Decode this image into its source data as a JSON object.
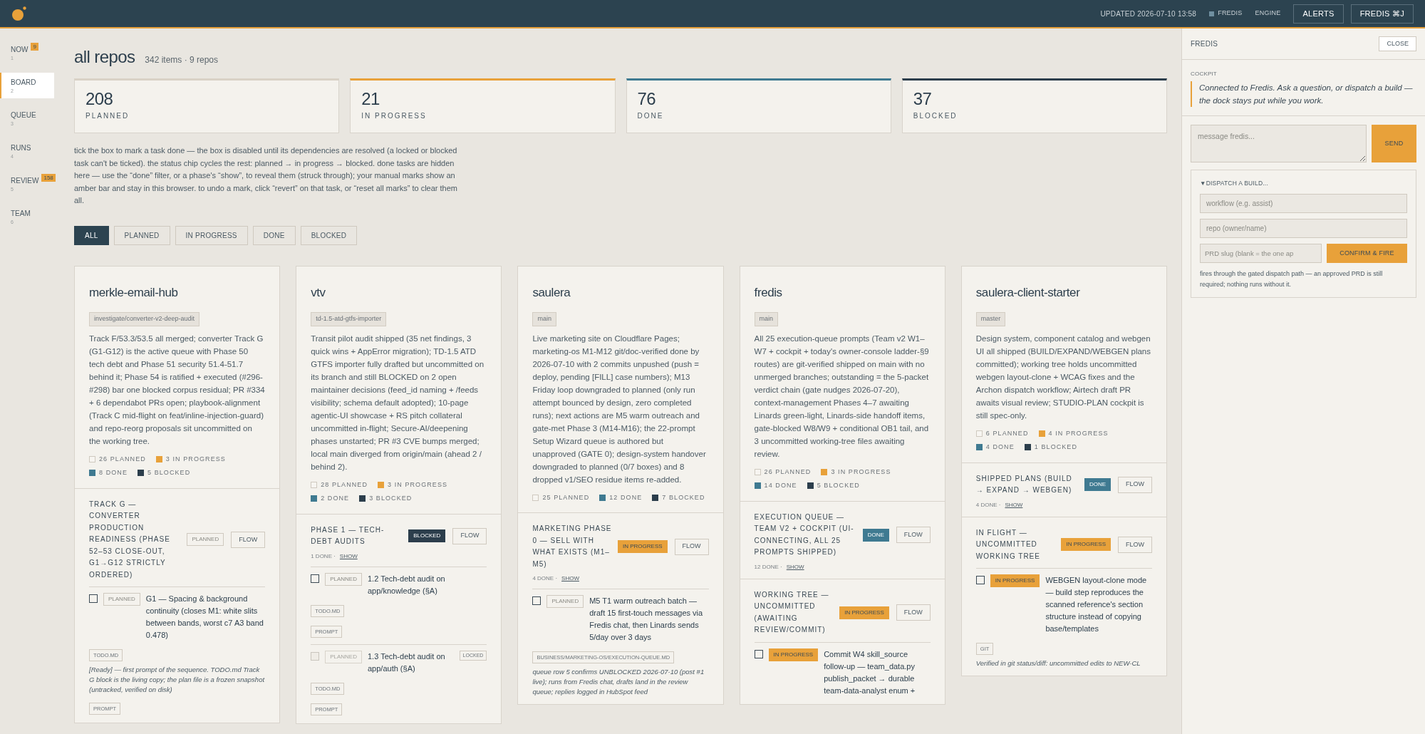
{
  "topbar": {
    "updated": "UPDATED 2026-07-10 13:58",
    "links": [
      {
        "label": "FREDIS",
        "indicator": true
      },
      {
        "label": "ENGINE",
        "indicator": false
      }
    ],
    "buttons": [
      "ALERTS",
      "FREDIS ⌘J"
    ]
  },
  "sidebar": {
    "items": [
      {
        "label": "NOW",
        "key": "1",
        "badge": "9",
        "selected": false
      },
      {
        "label": "BOARD",
        "key": "2",
        "selected": true
      },
      {
        "label": "QUEUE",
        "key": "3",
        "selected": false
      },
      {
        "label": "RUNS",
        "key": "4",
        "selected": false
      },
      {
        "label": "REVIEW",
        "key": "5",
        "badge": "158",
        "selected": false
      },
      {
        "label": "TEAM",
        "key": "6",
        "selected": false
      }
    ]
  },
  "header": {
    "title": "all repos",
    "subtitle": "342 items · 9 repos"
  },
  "stats": [
    {
      "value": "208",
      "label": "PLANNED",
      "color": "#d9d2c6"
    },
    {
      "value": "21",
      "label": "IN PROGRESS",
      "color": "#e8a13a"
    },
    {
      "value": "76",
      "label": "DONE",
      "color": "#3f7a91"
    },
    {
      "value": "37",
      "label": "BLOCKED",
      "color": "#2c3e4c"
    }
  ],
  "help": "tick the box to mark a task done — the box is disabled until its dependencies are resolved (a locked or blocked task can't be ticked). the status chip cycles the rest: planned → in progress → blocked. done tasks are hidden here — use the “done” filter, or a phase's “show”, to reveal them (struck through); your manual marks show an amber bar and stay in this browser. to undo a mark, click “revert” on that task, or “reset all marks” to clear them all.",
  "filters": [
    {
      "label": "ALL",
      "selected": true
    },
    {
      "label": "PLANNED",
      "selected": false
    },
    {
      "label": "IN PROGRESS",
      "selected": false
    },
    {
      "label": "DONE",
      "selected": false
    },
    {
      "label": "BLOCKED",
      "selected": false
    }
  ],
  "repos": [
    {
      "name": "merkle-email-hub",
      "branch": "investigate/converter-v2-deep-audit",
      "summary": "Track F/53.3/53.5 all merged; converter Track G (G1-G12) is the active queue with Phase 50 tech debt and Phase 51 security 51.4-51.7 behind it; Phase 54 is ratified + executed (#296-#298) bar one blocked corpus residual; PR #334 + 6 dependabot PRs open; playbook-alignment (Track C mid-flight on feat/inline-injection-guard) and repo-reorg proposals sit uncommitted on the working tree.",
      "counts": [
        {
          "label": "26 PLANNED",
          "kind": "planned"
        },
        {
          "label": "3 IN PROGRESS",
          "kind": "in_progress"
        },
        {
          "label": "8 DONE",
          "kind": "done"
        },
        {
          "label": "5 BLOCKED",
          "kind": "blocked"
        }
      ],
      "sections": [
        {
          "title": "TRACK G — CONVERTER PRODUCTION READINESS (PHASE 52–53 CLOSE-OUT, G1→G12 STRICTLY ORDERED)",
          "kind": "planned",
          "chip": "PLANNED",
          "flow": "FLOW",
          "tasks": [
            {
              "checked": false,
              "disabled": false,
              "kind": "planned",
              "chip": "PLANNED",
              "title": "G1 — Spacing & background continuity (closes M1: white slits between bands, worst c7 A3 band 0.478)",
              "items": [
                {
                  "kind": "tag",
                  "text": "TODO.MD"
                },
                {
                  "kind": "note",
                  "text": "[Ready] — first prompt of the sequence. TODO.md Track G block is the living copy; the plan file is a frozen snapshot (untracked, verified on disk)"
                },
                {
                  "kind": "tag",
                  "text": "PROMPT"
                }
              ]
            }
          ]
        }
      ]
    },
    {
      "name": "vtv",
      "branch": "td-1.5-atd-gtfs-importer",
      "summary": "Transit pilot audit shipped (35 net findings, 3 quick wins + AppError migration); TD-1.5 ATD GTFS importer fully drafted but uncommitted on its branch and still BLOCKED on 2 open maintainer decisions (feed_id naming + /feeds visibility; schema default adopted); 10-page agentic-UI showcase + RS pitch collateral uncommitted in-flight; Secure-AI/deepening phases unstarted; PR #3 CVE bumps merged; local main diverged from origin/main (ahead 2 / behind 2).",
      "counts": [
        {
          "label": "28 PLANNED",
          "kind": "planned"
        },
        {
          "label": "3 IN PROGRESS",
          "kind": "in_progress"
        },
        {
          "label": "2 DONE",
          "kind": "done"
        },
        {
          "label": "3 BLOCKED",
          "kind": "blocked"
        }
      ],
      "sections": [
        {
          "title": "PHASE 1 — TECH-DEBT AUDITS",
          "kind": "blocked",
          "chip": "BLOCKED",
          "flow": "FLOW",
          "meta": "1 DONE ·",
          "show": "SHOW",
          "tasks": [
            {
              "checked": false,
              "disabled": false,
              "kind": "planned",
              "chip": "PLANNED",
              "title": "1.2 Tech-debt audit on app/knowledge (§A)",
              "items": [
                {
                  "kind": "tag",
                  "text": "TODO.MD"
                },
                {
                  "kind": "tag",
                  "text": "PROMPT"
                }
              ]
            },
            {
              "checked": false,
              "disabled": true,
              "kind": "planned",
              "chip": "PLANNED",
              "title": "1.3 Tech-debt audit on app/auth (§A)",
              "lock": "LOCKED",
              "items": [
                {
                  "kind": "tag",
                  "text": "TODO.MD"
                },
                {
                  "kind": "tag",
                  "text": "PROMPT"
                }
              ]
            }
          ]
        }
      ]
    },
    {
      "name": "saulera",
      "branch": "main",
      "summary": "Live marketing site on Cloudflare Pages; marketing-os M1-M12 git/doc-verified done by 2026-07-10 with 2 commits unpushed (push = deploy, pending [FILL] case numbers); M13 Friday loop downgraded to planned (only run attempt bounced by design, zero completed runs); next actions are M5 warm outreach and gate-met Phase 3 (M14-M16); the 22-prompt Setup Wizard queue is authored but unapproved (GATE 0); design-system handover downgraded to planned (0/7 boxes) and 8 dropped v1/SEO residue items re-added.",
      "counts": [
        {
          "label": "25 PLANNED",
          "kind": "planned"
        },
        {
          "label": "12 DONE",
          "kind": "done"
        },
        {
          "label": "7 BLOCKED",
          "kind": "blocked"
        }
      ],
      "sections": [
        {
          "title": "MARKETING PHASE 0 — SELL WITH WHAT EXISTS (M1–M5)",
          "kind": "in_progress",
          "chip": "IN PROGRESS",
          "flow": "FLOW",
          "meta": "4 DONE ·",
          "show": "SHOW",
          "tasks": [
            {
              "checked": false,
              "disabled": false,
              "kind": "planned",
              "chip": "PLANNED",
              "title": "M5 T1 warm outreach batch — draft 15 first-touch messages via Fredis chat, then Linards sends 5/day over 3 days",
              "items": [
                {
                  "kind": "tag",
                  "text": "BUSINESS/MARKETING-OS/EXECUTION-QUEUE.MD"
                },
                {
                  "kind": "note",
                  "text": "queue row 5 confirms UNBLOCKED 2026-07-10 (post #1 live); runs from Fredis chat, drafts land in the review queue; replies logged in HubSpot feed"
                }
              ]
            }
          ]
        }
      ]
    },
    {
      "name": "fredis",
      "branch": "main",
      "summary": "All 25 execution-queue prompts (Team v2 W1–W7 + cockpit + today's owner-console ladder-§9 routes) are git-verified shipped on main with no unmerged branches; outstanding = the 5-packet verdict chain (gate nudges 2026-07-20), context-management Phases 4–7 awaiting Linards green-light, Linards-side handoff items, gate-blocked W8/W9 + conditional OB1 tail, and 3 uncommitted working-tree files awaiting review.",
      "counts": [
        {
          "label": "26 PLANNED",
          "kind": "planned"
        },
        {
          "label": "3 IN PROGRESS",
          "kind": "in_progress"
        },
        {
          "label": "14 DONE",
          "kind": "done"
        },
        {
          "label": "5 BLOCKED",
          "kind": "blocked"
        }
      ],
      "sections": [
        {
          "title": "EXECUTION QUEUE — TEAM V2 + COCKPIT (UI-CONNECTING, ALL 25 PROMPTS SHIPPED)",
          "kind": "done",
          "chip": "DONE",
          "flow": "FLOW",
          "meta": "12 DONE ·",
          "show": "SHOW"
        },
        {
          "title": "WORKING TREE — UNCOMMITTED (AWAITING REVIEW/COMMIT)",
          "kind": "in_progress",
          "chip": "IN PROGRESS",
          "flow": "FLOW",
          "tasks": [
            {
              "checked": false,
              "disabled": false,
              "kind": "in_progress",
              "chip": "IN PROGRESS",
              "title": "Commit W4 skill_source follow-up — team_data.py publish_packet → durable team-data-analyst enum +"
            }
          ]
        }
      ]
    },
    {
      "name": "saulera-client-starter",
      "branch": "master",
      "summary": "Design system, component catalog and webgen UI all shipped (BUILD/EXPAND/WEBGEN plans committed); working tree holds uncommitted webgen layout-clone + WCAG fixes and the Archon dispatch workflow; Airtech draft PR awaits visual review; STUDIO-PLAN cockpit is still spec-only.",
      "counts": [
        {
          "label": "6 PLANNED",
          "kind": "planned"
        },
        {
          "label": "4 IN PROGRESS",
          "kind": "in_progress"
        },
        {
          "label": "4 DONE",
          "kind": "done"
        },
        {
          "label": "1 BLOCKED",
          "kind": "blocked"
        }
      ],
      "sections": [
        {
          "title": "SHIPPED PLANS (BUILD → EXPAND → WEBGEN)",
          "kind": "done",
          "chip": "DONE",
          "flow": "FLOW",
          "meta": "4 DONE ·",
          "show": "SHOW"
        },
        {
          "title": "IN FLIGHT — UNCOMMITTED WORKING TREE",
          "kind": "in_progress",
          "chip": "IN PROGRESS",
          "flow": "FLOW",
          "tasks": [
            {
              "checked": false,
              "disabled": false,
              "kind": "in_progress",
              "chip": "IN PROGRESS",
              "title": "WEBGEN layout-clone mode — build step reproduces the scanned reference's section structure instead of copying base/templates",
              "items": [
                {
                  "kind": "tag",
                  "text": "GIT"
                },
                {
                  "kind": "note",
                  "text": "Verified in git status/diff: uncommitted edits to NEW-CL"
                }
              ]
            }
          ]
        }
      ]
    }
  ],
  "dock": {
    "title": "FREDIS",
    "close": "CLOSE",
    "cockpit_label": "COCKPIT",
    "message": "Connected to Fredis. Ask a question, or dispatch a build — the dock stays put while you work.",
    "input": {
      "placeholder": "message fredis..."
    },
    "send": "SEND",
    "dispatch": {
      "summary": "▼DISPATCH A BUILD...",
      "fields": [
        {
          "placeholder": "workflow (e.g. assist)"
        },
        {
          "placeholder": "repo (owner/name)"
        },
        {
          "placeholder": "PRD slug (blank = the one ap"
        }
      ],
      "button": "CONFIRM & FIRE",
      "note": "fires through the gated dispatch path — an approved PRD is still required; nothing runs without it."
    }
  }
}
